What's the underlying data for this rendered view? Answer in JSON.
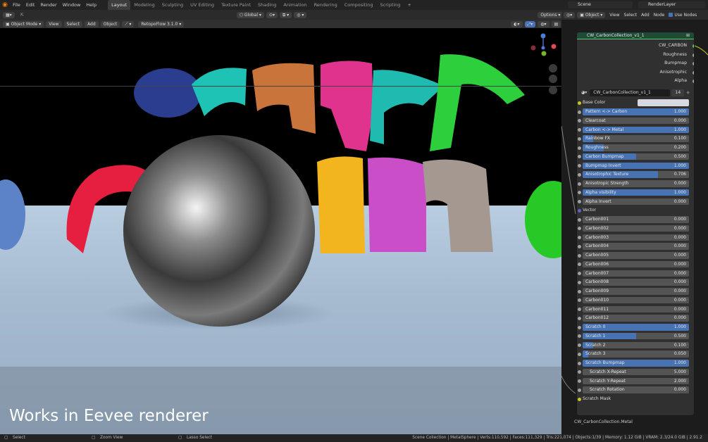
{
  "topbar": {
    "menu": [
      "File",
      "Edit",
      "Render",
      "Window",
      "Help"
    ],
    "workspaces": [
      "Layout",
      "Modeling",
      "Sculpting",
      "UV Editing",
      "Texture Paint",
      "Shading",
      "Animation",
      "Rendering",
      "Compositing",
      "Scripting"
    ],
    "active_workspace": "Layout",
    "add": "+",
    "scene": "Scene",
    "view_layer": "RenderLayer"
  },
  "viewport_header": {
    "orientation": "Global",
    "options": "Options",
    "mode": "Object Mode",
    "view": "View",
    "select": "Select",
    "add": "Add",
    "object": "Object",
    "addon": "RetopoFlow 3.1.0"
  },
  "node_editor_header": {
    "object": "Object",
    "view": "View",
    "select": "Select",
    "add": "Add",
    "node": "Node",
    "use_nodes": "Use Nodes"
  },
  "caption": "Works in Eevee renderer",
  "node": {
    "title": "CW_CarbonCollection_v1_1",
    "outputs": [
      "CW_CARBON",
      "Roughness",
      "Bumpmap",
      "Anisotrophic",
      "Alpha"
    ],
    "group_name": "CW_CarbonCollection_v1_1",
    "users": "14",
    "base_color_label": "Base Color",
    "vector_label": "Vector",
    "scratch_mask_label": "Scratch Mask",
    "params_a": [
      {
        "name": "Pattern <-> Carbon",
        "value": "1.000",
        "frac": 1.0
      },
      {
        "name": "Clearcoat",
        "value": "0.000",
        "frac": 0.0
      },
      {
        "name": "Carbon <-> Metal",
        "value": "1.000",
        "frac": 1.0
      },
      {
        "name": "Rainbow FX",
        "value": "0.100",
        "frac": 0.1
      },
      {
        "name": "Roughness",
        "value": "0.200",
        "frac": 0.2
      },
      {
        "name": "Carbon Bumpmap",
        "value": "0.500",
        "frac": 0.5
      },
      {
        "name": "Bumpmap Invert",
        "value": "1.000",
        "frac": 1.0
      },
      {
        "name": "Anisotrophic Texture",
        "value": "0.706",
        "frac": 0.706
      },
      {
        "name": "Anisotropic Strength",
        "value": "0.000",
        "frac": 0.0
      },
      {
        "name": "Alpha visibility",
        "value": "1.000",
        "frac": 1.0
      },
      {
        "name": "Alpha Invert",
        "value": "0.000",
        "frac": 0.0
      }
    ],
    "params_b": [
      {
        "name": "Carbon001",
        "value": "0.000",
        "frac": 0.0
      },
      {
        "name": "Carbon002",
        "value": "0.000",
        "frac": 0.0
      },
      {
        "name": "Carbon003",
        "value": "0.000",
        "frac": 0.0
      },
      {
        "name": "Carbon004",
        "value": "0.000",
        "frac": 0.0
      },
      {
        "name": "Carbon005",
        "value": "0.000",
        "frac": 0.0
      },
      {
        "name": "Carbon006",
        "value": "0.000",
        "frac": 0.0
      },
      {
        "name": "Carbon007",
        "value": "0.000",
        "frac": 0.0
      },
      {
        "name": "Carbon008",
        "value": "0.000",
        "frac": 0.0
      },
      {
        "name": "Carbon009",
        "value": "0.000",
        "frac": 0.0
      },
      {
        "name": "Carbon010",
        "value": "0.000",
        "frac": 0.0
      },
      {
        "name": "Carbon011",
        "value": "0.000",
        "frac": 0.0
      },
      {
        "name": "Carbon012",
        "value": "0.000",
        "frac": 0.0
      },
      {
        "name": "Scratch 0",
        "value": "1.000",
        "frac": 1.0
      },
      {
        "name": "Scratch 1",
        "value": "0.500",
        "frac": 0.5
      },
      {
        "name": "Scratch 2",
        "value": "0.100",
        "frac": 0.1
      },
      {
        "name": "Scratch 3",
        "value": "0.050",
        "frac": 0.05
      },
      {
        "name": "Scratch Bumpmap",
        "value": "1.000",
        "frac": 1.0
      },
      {
        "name": "Scratch X-Repeat",
        "value": "5.000",
        "frac": 0.0
      },
      {
        "name": "Scratch Y-Repeat",
        "value": "2.000",
        "frac": 0.0
      },
      {
        "name": "Scratch Rotation",
        "value": "0.000",
        "frac": 0.0
      }
    ],
    "footer": "CW_CarbonCollection.Metal"
  },
  "statusbar": {
    "left1": "Select",
    "left2": "Zoom View",
    "left3": "Lasso Select",
    "right": "Scene Collection | MetalSphere | Verts:110,592 | Faces:111,329 | Tris:221,074 | Objects:1/39 | Memory: 1.12 GiB | VRAM: 2.3/24.0 GiB | 2.91.2"
  },
  "colors": {
    "accent": "#4772b3",
    "node_header": "#1f4a35",
    "socket_yellow": "#c7c729",
    "socket_grey": "#a1a1a1",
    "socket_purple": "#6363c7"
  }
}
